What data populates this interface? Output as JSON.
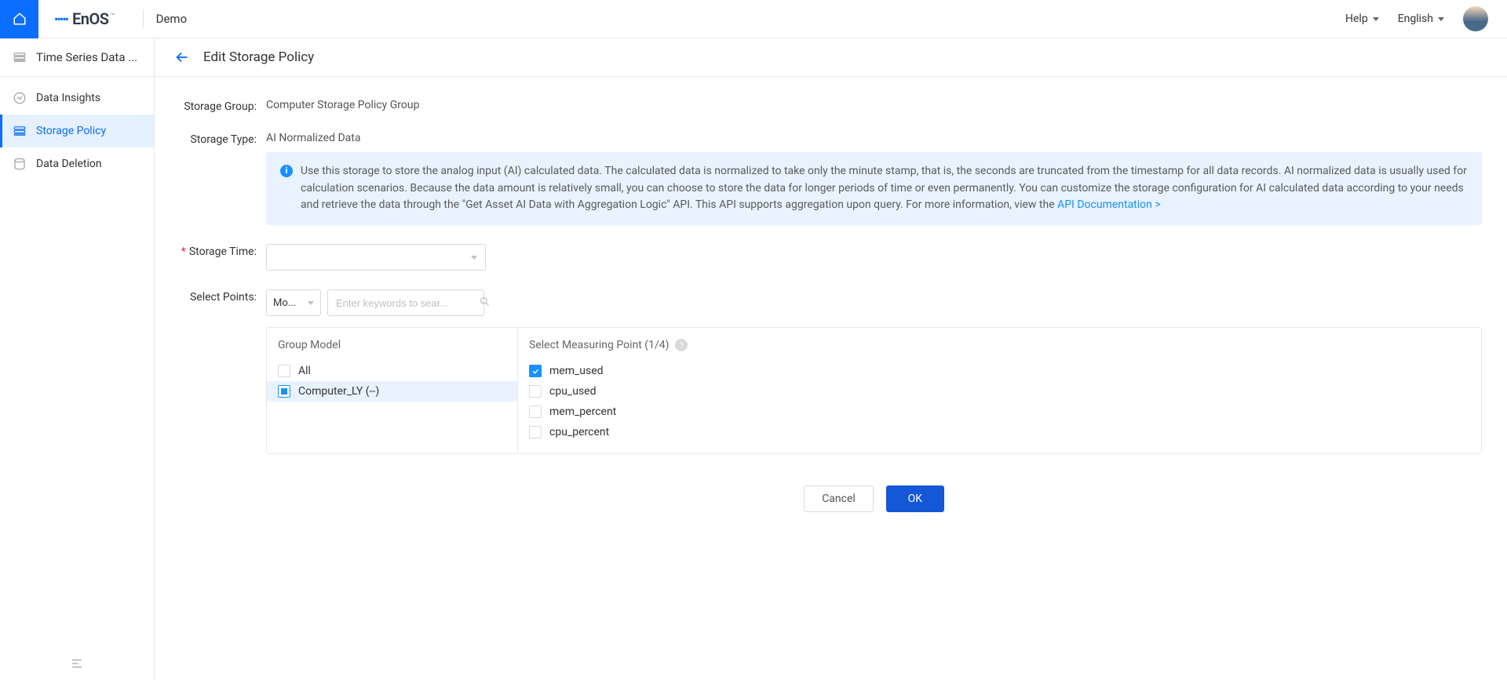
{
  "header": {
    "logo_text": "EnOS",
    "logo_tm": "™",
    "tenant": "Demo",
    "help_label": "Help",
    "lang_label": "English"
  },
  "sidebar": {
    "title": "Time Series Data ...",
    "items": [
      {
        "label": "Data Insights",
        "active": false
      },
      {
        "label": "Storage Policy",
        "active": true
      },
      {
        "label": "Data Deletion",
        "active": false
      }
    ]
  },
  "page": {
    "title": "Edit Storage Policy",
    "storage_group": {
      "label": "Storage Group:",
      "value": "Computer Storage Policy Group"
    },
    "storage_type": {
      "label": "Storage Type:",
      "value": "AI Normalized Data",
      "info_text": "Use this storage to store the analog input (AI) calculated data. The calculated data is normalized to take only the minute stamp, that is, the seconds are truncated from the timestamp for all data records. AI normalized data is usually used for calculation scenarios. Because the data amount is relatively small, you can choose to store the data for longer periods of time or even permanently. You can customize the storage configuration for AI calculated data according to your needs and retrieve the data through the \"Get Asset AI Data with Aggregation Logic\" API. This API supports aggregation upon query. For more information, view the ",
      "info_link": "API Documentation >"
    },
    "storage_time": {
      "label": "Storage Time:"
    },
    "select_points": {
      "label": "Select Points:",
      "filter_dropdown": "Mo...",
      "search_placeholder": "Enter keywords to sear..."
    },
    "group_model": {
      "heading": "Group Model",
      "all_label": "All",
      "items": [
        {
          "label": "Computer_LY (--)"
        }
      ]
    },
    "measuring_points": {
      "heading": "Select Measuring Point (1/4)",
      "items": [
        {
          "label": "mem_used",
          "checked": true
        },
        {
          "label": "cpu_used",
          "checked": false
        },
        {
          "label": "mem_percent",
          "checked": false
        },
        {
          "label": "cpu_percent",
          "checked": false
        }
      ]
    },
    "actions": {
      "cancel": "Cancel",
      "ok": "OK"
    }
  }
}
